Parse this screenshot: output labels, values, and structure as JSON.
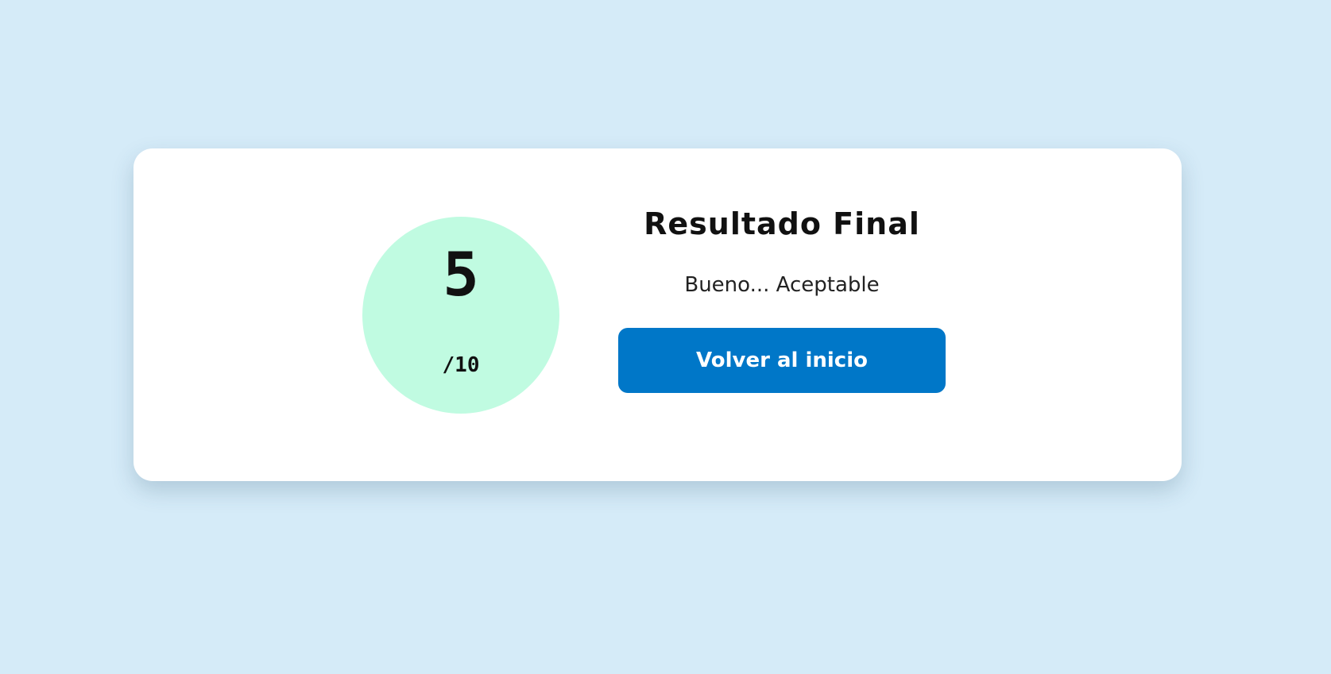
{
  "result": {
    "score": "5",
    "max_score": "/10",
    "title": "Resultado Final",
    "message": "Bueno... Aceptable",
    "back_button_label": "Volver al inicio"
  },
  "colors": {
    "background": "#d5ebf8",
    "card": "#ffffff",
    "score_circle": "#c0fbe1",
    "button": "#0077c8",
    "button_text": "#ffffff",
    "text": "#111111"
  }
}
